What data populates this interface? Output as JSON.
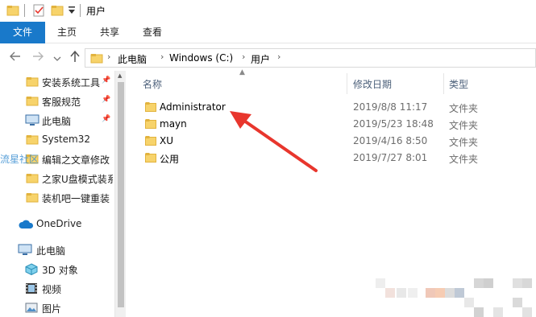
{
  "titlebar": {
    "title": "用户",
    "icons": [
      "folder-icon",
      "properties-checklist-icon",
      "new-folder-icon",
      "dropdown-arrow-icon"
    ]
  },
  "ribbon": {
    "file": "文件",
    "home": "主页",
    "share": "共享",
    "view": "查看"
  },
  "address": {
    "crumbs": [
      "此电脑",
      "Windows (C:)",
      "用户"
    ]
  },
  "sidebar": {
    "quick_access": [
      {
        "label": "安装系统工具",
        "pinned": true
      },
      {
        "label": "客服规范",
        "pinned": true
      },
      {
        "label": "此电脑",
        "pinned": true
      },
      {
        "label": "System32",
        "pinned": false
      },
      {
        "label": "编辑之文章修改",
        "pinned": false
      },
      {
        "label": "之家U盘模式装系",
        "pinned": false
      },
      {
        "label": "装机吧一键重装",
        "pinned": false
      }
    ],
    "onedrive": "OneDrive",
    "this_pc": "此电脑",
    "pc_items": [
      "3D 对象",
      "视频",
      "图片"
    ]
  },
  "watermark": "流星社区",
  "columns": {
    "name": "名称",
    "modified": "修改日期",
    "type": "类型"
  },
  "files": [
    {
      "name": "Administrator",
      "modified": "2019/8/8 11:17",
      "type": "文件夹"
    },
    {
      "name": "mayn",
      "modified": "2019/5/23 18:48",
      "type": "文件夹"
    },
    {
      "name": "XU",
      "modified": "2019/4/16 8:50",
      "type": "文件夹"
    },
    {
      "name": "公用",
      "modified": "2019/7/27 8:01",
      "type": "文件夹"
    }
  ],
  "colors": {
    "accent": "#1979ca",
    "folder": "#f7d36b",
    "folder_dark": "#e2b33e",
    "arrow": "#e8362d"
  }
}
